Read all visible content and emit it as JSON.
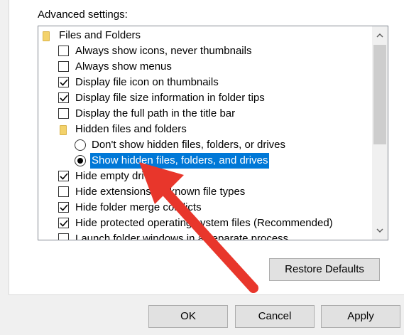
{
  "advanced_settings": {
    "label": "Advanced settings:",
    "tree": [
      {
        "type": "folder",
        "label": "Files and Folders",
        "indent": 0
      },
      {
        "type": "checkbox",
        "label": "Always show icons, never thumbnails",
        "checked": false
      },
      {
        "type": "checkbox",
        "label": "Always show menus",
        "checked": false
      },
      {
        "type": "checkbox",
        "label": "Display file icon on thumbnails",
        "checked": true
      },
      {
        "type": "checkbox",
        "label": "Display file size information in folder tips",
        "checked": true
      },
      {
        "type": "checkbox",
        "label": "Display the full path in the title bar",
        "checked": false
      },
      {
        "type": "folder",
        "label": "Hidden files and folders",
        "indent": 1
      },
      {
        "type": "radio",
        "label": "Don't show hidden files, folders, or drives",
        "selected": false
      },
      {
        "type": "radio",
        "label": "Show hidden files, folders, and drives",
        "selected": true
      },
      {
        "type": "checkbox",
        "label": "Hide empty drives",
        "checked": true
      },
      {
        "type": "checkbox",
        "label": "Hide extensions for known file types",
        "checked": false
      },
      {
        "type": "checkbox",
        "label": "Hide folder merge conflicts",
        "checked": true
      },
      {
        "type": "checkbox",
        "label": "Hide protected operating system files (Recommended)",
        "checked": true
      },
      {
        "type": "checkbox",
        "label": "Launch folder windows in a separate process",
        "checked": false
      }
    ]
  },
  "buttons": {
    "restore_defaults": "Restore Defaults",
    "ok": "OK",
    "cancel": "Cancel",
    "apply": "Apply"
  },
  "colors": {
    "selection": "#0078d7",
    "arrow": "#e8362b"
  },
  "icons": {
    "folder": "folder-icon",
    "checkmark": "checkmark-icon",
    "scroll_up": "chevron-up-icon",
    "scroll_down": "chevron-down-icon"
  }
}
